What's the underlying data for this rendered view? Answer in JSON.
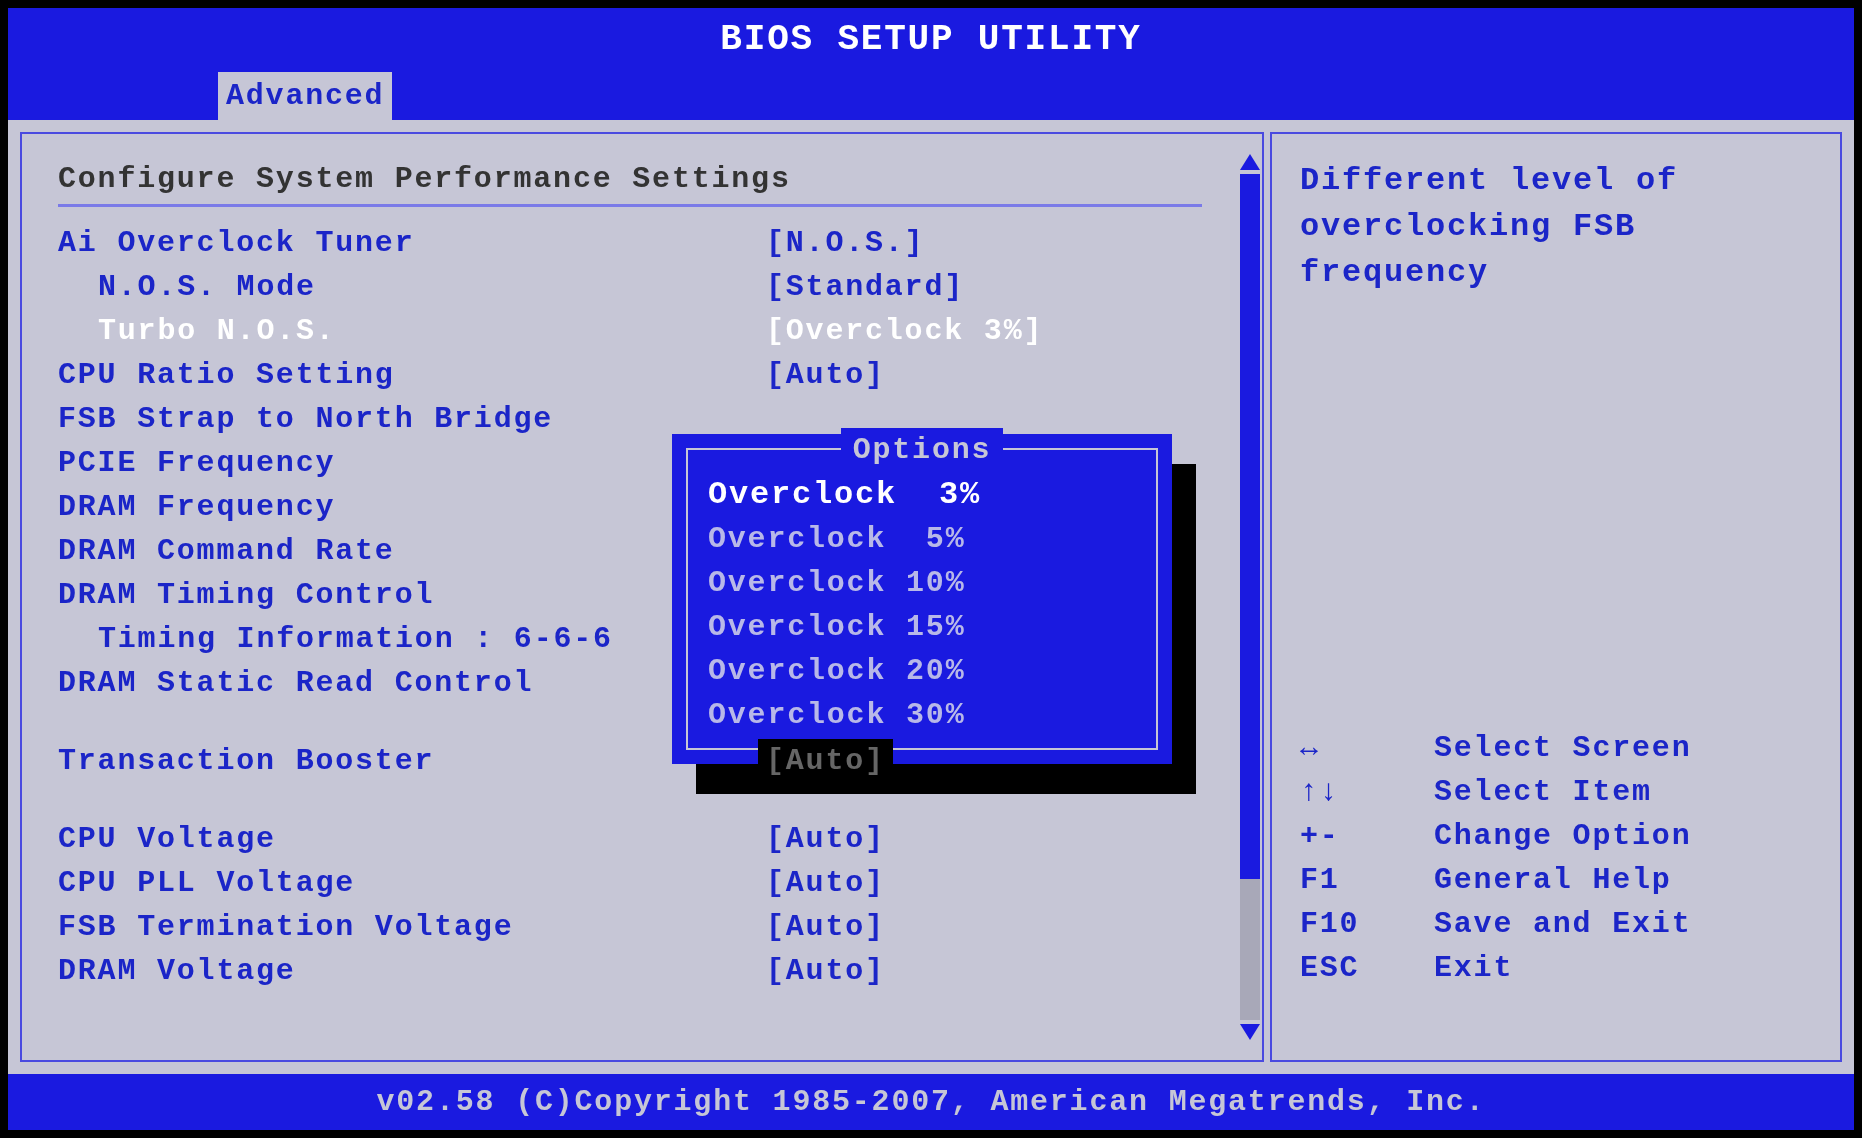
{
  "title": "BIOS SETUP UTILITY",
  "tabs": [
    {
      "label": "Advanced",
      "selected": true
    }
  ],
  "section_title": "Configure System Performance Settings",
  "groups": [
    {
      "items": [
        {
          "label": "Ai Overclock Tuner",
          "value": "[N.O.S.]",
          "selected": false,
          "children": [
            {
              "label": "N.O.S. Mode",
              "value": "[Standard]",
              "selected": false
            },
            {
              "label": "Turbo N.O.S.",
              "value": "[Overclock 3%]",
              "selected": true
            }
          ]
        },
        {
          "label": "CPU Ratio Setting",
          "value": "[Auto]",
          "selected": false
        },
        {
          "label": "FSB Strap to North Bridge",
          "selected": false
        },
        {
          "label": "PCIE Frequency",
          "selected": false
        },
        {
          "label": "DRAM Frequency",
          "selected": false
        },
        {
          "label": "DRAM Command Rate",
          "selected": false
        },
        {
          "label": "DRAM Timing Control",
          "selected": false,
          "children": [
            {
              "label": "Timing Information : 6-6-6",
              "selected": false
            }
          ]
        },
        {
          "label": "DRAM Static Read Control",
          "selected": false
        }
      ]
    },
    {
      "items": [
        {
          "label": "Transaction Booster",
          "value": "[Auto]",
          "dimmed": true,
          "selected": false
        }
      ]
    },
    {
      "items": [
        {
          "label": "CPU Voltage",
          "value": "[Auto]",
          "selected": false
        },
        {
          "label": "CPU PLL Voltage",
          "value": "[Auto]",
          "selected": false
        },
        {
          "label": "FSB Termination Voltage",
          "value": "[Auto]",
          "selected": false
        },
        {
          "label": "DRAM Voltage",
          "value": "[Auto]",
          "selected": false
        }
      ]
    }
  ],
  "popup": {
    "title": "Options",
    "options": [
      {
        "label": "Overclock  3%",
        "selected": true
      },
      {
        "label": "Overclock  5%",
        "selected": false
      },
      {
        "label": "Overclock 10%",
        "selected": false
      },
      {
        "label": "Overclock 15%",
        "selected": false
      },
      {
        "label": "Overclock 20%",
        "selected": false
      },
      {
        "label": "Overclock 30%",
        "selected": false
      }
    ]
  },
  "help_text": "Different level of overclocking FSB frequency",
  "keys": [
    {
      "key": "↔",
      "action": "Select Screen"
    },
    {
      "key": "↑↓",
      "action": "Select Item"
    },
    {
      "key": "+-",
      "action": "Change Option"
    },
    {
      "key": "F1",
      "action": "General Help"
    },
    {
      "key": "F10",
      "action": "Save and Exit"
    },
    {
      "key": "ESC",
      "action": "Exit"
    }
  ],
  "footer": "v02.58 (C)Copyright 1985-2007, American Megatrends, Inc."
}
